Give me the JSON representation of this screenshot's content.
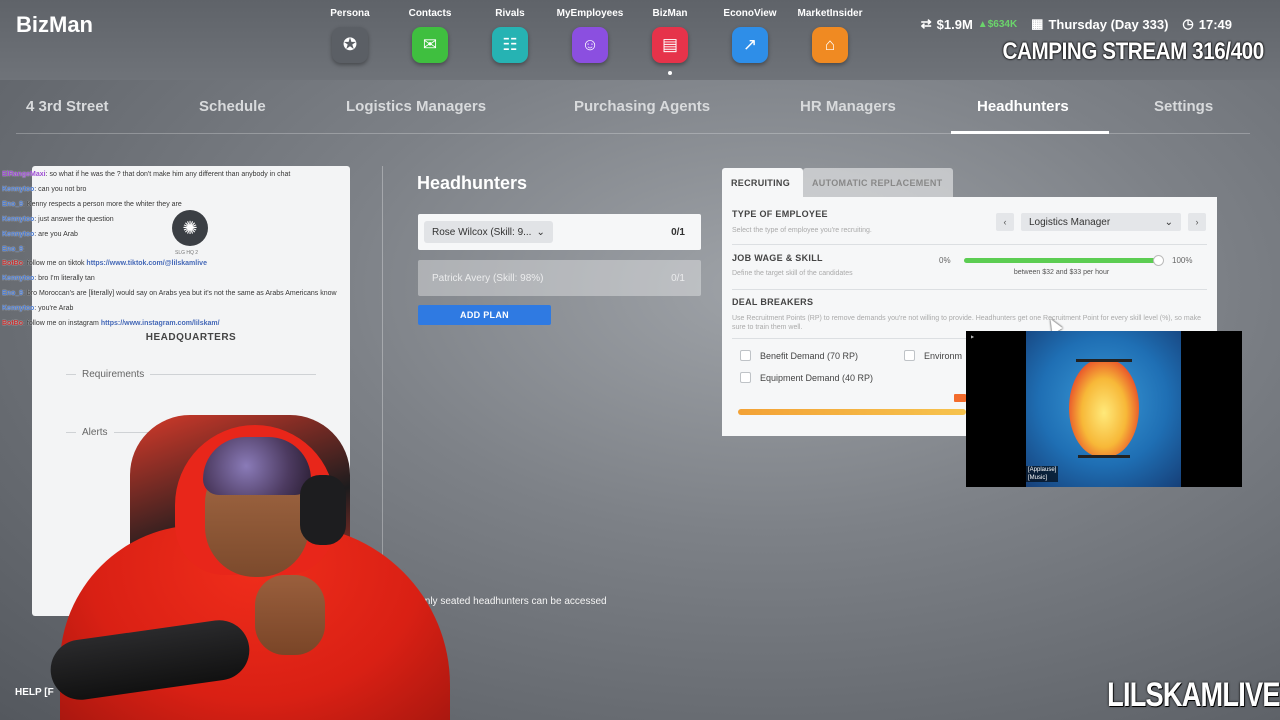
{
  "app": {
    "brand": "BizMan"
  },
  "apps": [
    {
      "label": "Persona",
      "icon": "persona-icon",
      "glyph": "✪",
      "color": "#5b5f65"
    },
    {
      "label": "Contacts",
      "icon": "chat-icon",
      "glyph": "✉",
      "color": "#3fbf3f"
    },
    {
      "label": "Rivals",
      "icon": "group-icon",
      "glyph": "☷",
      "color": "#26b3b3"
    },
    {
      "label": "MyEmployees",
      "icon": "badge-icon",
      "glyph": "☺",
      "color": "#8b4fe0"
    },
    {
      "label": "BizMan",
      "icon": "store-icon",
      "glyph": "▤",
      "color": "#e6334a"
    },
    {
      "label": "EconoView",
      "icon": "trend-icon",
      "glyph": "↗",
      "color": "#2e8ee8"
    },
    {
      "label": "MarketInsider",
      "icon": "building-icon",
      "glyph": "⌂",
      "color": "#f08a22"
    }
  ],
  "stats": {
    "money": "$1.9M",
    "change": "▲$634K",
    "date": "Thursday (Day 333)",
    "time": "17:49"
  },
  "stream_title": "CAMPING STREAM 316/400",
  "tabs": [
    "4 3rd Street",
    "Schedule",
    "Logistics Managers",
    "Purchasing Agents",
    "HR Managers",
    "Headhunters",
    "Settings"
  ],
  "active_tab": "Headhunters",
  "hq": {
    "small_text": "SLG HQ 2",
    "title": "HEADQUARTERS",
    "requirements": "Requirements",
    "alerts": "Alerts"
  },
  "chat": [
    {
      "user": "ElRangeMaxi",
      "msg": ": so what if he was the ? that don't make him any different than anybody in chat"
    },
    {
      "user": "Kennytoo",
      "msg": ": can you not bro"
    },
    {
      "user": "Eno_9",
      "msg": ": Kenny respects a person more the whiter they are"
    },
    {
      "user": "Kennytoo",
      "msg": ": just answer the question"
    },
    {
      "user": "Kennytoo",
      "msg": ": are you Arab"
    },
    {
      "user": "Eno_9",
      "msg": ":"
    },
    {
      "user": "BotBo",
      "msg": ": follow me on tiktok ",
      "link": "https://www.tiktok.com/@lilskamlive"
    },
    {
      "user": "Kennytoo",
      "msg": ": bro I'm literally tan"
    },
    {
      "user": "Eno_9",
      "msg": ": bro Moroccan's are [literally] would say on Arabs yea but it's not the same as Arabs Americans know"
    },
    {
      "user": "Kennytoo",
      "msg": ": you're Arab"
    },
    {
      "user": "BotBo",
      "msg": ": follow me on instagram ",
      "link": "https://www.instagram.com/lilskam/"
    }
  ],
  "headhunters": {
    "title": "Headhunters",
    "plans": [
      {
        "label": "Rose Wilcox (Skill: 9...",
        "count": "0/1"
      },
      {
        "label": "Patrick Avery (Skill: 98%)",
        "count": "0/1"
      }
    ],
    "add_plan": "ADD PLAN",
    "note": "Only seated headhunters can be accessed"
  },
  "recruit": {
    "tab_recruiting": "RECRUITING",
    "tab_auto": "AUTOMATIC REPLACEMENT",
    "type_label": "TYPE OF EMPLOYEE",
    "type_sub": "Select the type of employee you're recruiting.",
    "employee_type": "Logistics Manager",
    "wage_label": "JOB WAGE & SKILL",
    "wage_sub": "Define the target skill of the candidates",
    "slider_min": "0%",
    "slider_max": "100%",
    "slider_value": 1.0,
    "wage_text": "between $32 and $33 per hour",
    "deal_label": "DEAL BREAKERS",
    "deal_desc": "Use Recruitment Points (RP) to remove demands you're not willing to provide. Headhunters get one Recruitment Point for every skill level (%), so make sure to train them well.",
    "benefit": "Benefit Demand (70 RP)",
    "environment": "Environm",
    "equipment": "Equipment Demand (40 RP)",
    "orange_tag": "PO"
  },
  "video": {
    "top_text": "Lofi Vibe",
    "caption_1": "[Applause]",
    "caption_2": "[Music]"
  },
  "help": "HELP [F",
  "watermark": "LILSKAMLIVE"
}
